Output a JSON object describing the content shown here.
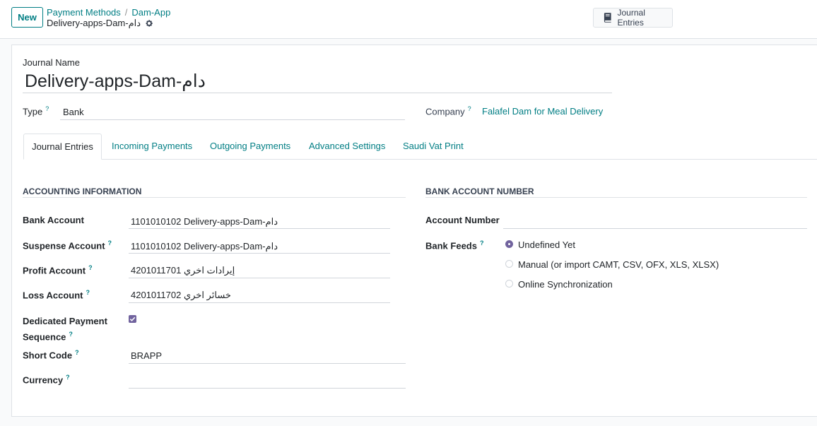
{
  "toolbar": {
    "new_label": "New",
    "breadcrumb": [
      "Payment Methods",
      "Dam-App"
    ],
    "record_name": "Delivery-apps-Dam-دام",
    "smart_button_label": "Journal Entries"
  },
  "form": {
    "journal_name_label": "Journal Name",
    "journal_name_value": "Delivery-apps-Dam-دام",
    "type_label": "Type",
    "type_value": "Bank",
    "company_label": "Company",
    "company_value": "Falafel Dam for Meal Delivery",
    "help_mark": "?"
  },
  "tabs": [
    "Journal Entries",
    "Incoming Payments",
    "Outgoing Payments",
    "Advanced Settings",
    "Saudi Vat Print"
  ],
  "accounting": {
    "title": "ACCOUNTING INFORMATION",
    "bank_account_label": "Bank Account",
    "bank_account_value": "1101010102 Delivery-apps-Dam-دام",
    "suspense_account_label": "Suspense Account",
    "suspense_account_value": "1101010102 Delivery-apps-Dam-دام",
    "profit_account_label": "Profit Account",
    "profit_account_value": "4201011701 إيرادات اخري",
    "loss_account_label": "Loss Account",
    "loss_account_value": "4201011702 خسائر اخري",
    "dedicated_label_1": "Dedicated Payment",
    "dedicated_label_2": "Sequence",
    "dedicated_checked": true,
    "short_code_label": "Short Code",
    "short_code_value": "BRAPP",
    "currency_label": "Currency",
    "currency_value": ""
  },
  "bank": {
    "title": "BANK ACCOUNT NUMBER",
    "account_number_label": "Account Number",
    "account_number_value": "",
    "bank_feeds_label": "Bank Feeds",
    "options": [
      "Undefined Yet",
      "Manual (or import CAMT, CSV, OFX, XLS, XLSX)",
      "Online Synchronization"
    ],
    "selected_option": "Undefined Yet"
  },
  "colors": {
    "accent": "#017e84",
    "checkbox": "#71639e"
  }
}
